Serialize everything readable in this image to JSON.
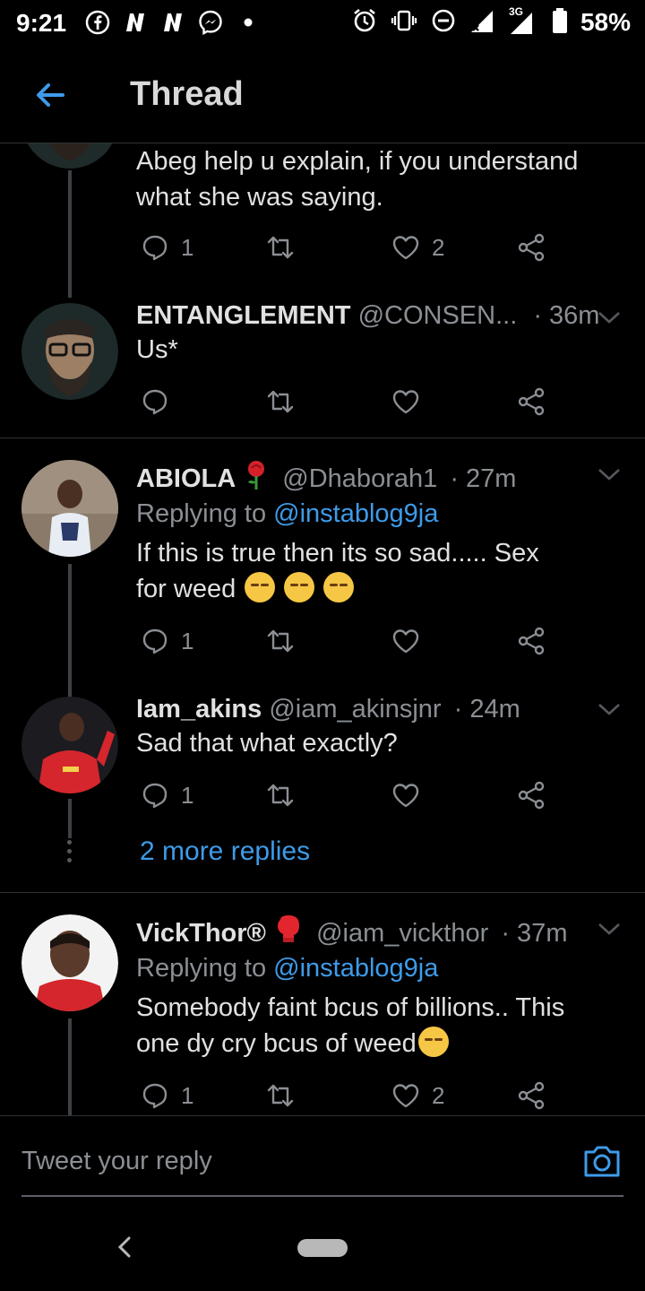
{
  "status_bar": {
    "time": "9:21",
    "network": "3G",
    "battery": "58%"
  },
  "header": {
    "title": "Thread"
  },
  "tweets": [
    {
      "text": "Abeg help u explain, if you understand what she was saying.",
      "reply_count": "1",
      "retweet_count": "",
      "like_count": "2"
    },
    {
      "name": "ENTANGLEMENT",
      "handle": "@CONSEN...",
      "time": "· 36m",
      "text": "Us*",
      "reply_count": "",
      "retweet_count": "",
      "like_count": ""
    },
    {
      "name": "ABIOLA",
      "name_emoji": "rose-emoji",
      "handle": "@Dhaborah1",
      "time": "· 27m",
      "replying_prefix": "Replying to",
      "replying_to": "@instablog9ja",
      "text": "If this is true then its so sad..... Sex for weed",
      "text_emojis": [
        "pensive-face-emoji",
        "pensive-face-emoji",
        "pensive-face-emoji"
      ],
      "reply_count": "1",
      "retweet_count": "",
      "like_count": ""
    },
    {
      "name": "Iam_akins",
      "handle": "@iam_akinsjnr",
      "time": "· 24m",
      "text": "Sad that what exactly?",
      "reply_count": "1",
      "retweet_count": "",
      "like_count": ""
    },
    {
      "name": "VickThor®",
      "name_emoji": "boxing-glove-emoji",
      "handle": "@iam_vickthor",
      "time": "· 37m",
      "replying_prefix": "Replying to",
      "replying_to": "@instablog9ja",
      "text": "Somebody faint bcus of billions.. This one dy cry bcus of weed",
      "text_emojis": [
        "crying-face-emoji"
      ],
      "reply_count": "1",
      "retweet_count": "",
      "like_count": "2"
    }
  ],
  "more_replies": "2 more replies",
  "compose": {
    "placeholder": "Tweet your reply"
  },
  "colors": {
    "accent": "#3e9be9",
    "background": "#000000",
    "muted": "#8b8f94",
    "divider": "#2f3336"
  },
  "icons": [
    "back-arrow-icon",
    "reply-icon",
    "retweet-icon",
    "like-icon",
    "share-icon",
    "chevron-down-icon",
    "camera-icon"
  ]
}
